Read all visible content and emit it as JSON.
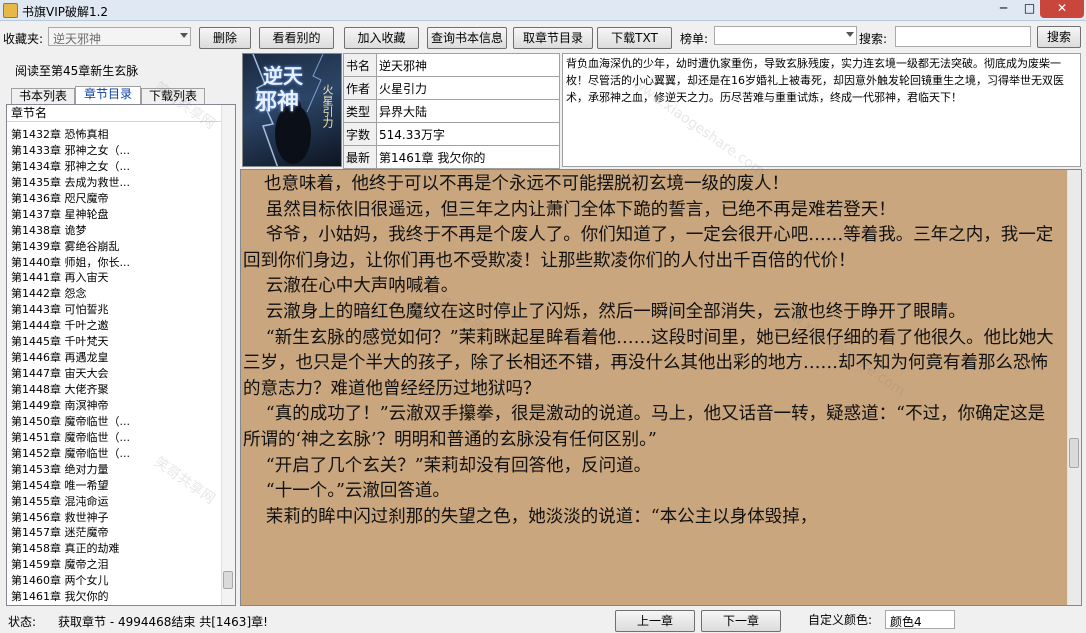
{
  "window": {
    "title": "书旗VIP破解1.2",
    "minimize": "─",
    "maximize": "□",
    "close": "✕"
  },
  "toolbar": {
    "favorites_label": "收藏夹:",
    "favorites_value": "逆天邪神",
    "delete_label": "删除",
    "see_other_label": "看看别的",
    "add_favorite_label": "加入收藏",
    "query_info_label": "查询书本信息",
    "fetch_toc_label": "取章节目录",
    "download_txt_label": "下载TXT",
    "ranking_label": "榜单:",
    "ranking_value": "",
    "search_label": "搜索:",
    "search_value": "",
    "search_button_label": "搜索"
  },
  "reading_progress": "阅读至第45章新生玄脉",
  "tabs": [
    {
      "label": "书本列表",
      "active": false
    },
    {
      "label": "章节目录",
      "active": true
    },
    {
      "label": "下载列表",
      "active": false
    }
  ],
  "chapter_list": {
    "header": "章节名",
    "items": [
      "第1432章 恐怖真相",
      "第1433章 邪神之女（...",
      "第1434章 邪神之女（...",
      "第1435章 去成为救世...",
      "第1436章 咫尺魔帝",
      "第1437章 星神轮盘",
      "第1438章 诡梦",
      "第1439章 雾绝谷崩乱",
      "第1440章 师姐，你长...",
      "第1441章 再入宙天",
      "第1442章 怨念",
      "第1443章 可怕誓兆",
      "第1444章 千叶之邀",
      "第1445章 千叶梵天",
      "第1446章 再遇龙皇",
      "第1447章 宙天大会",
      "第1448章 大佬齐聚",
      "第1449章 南溟神帝",
      "第1450章 魔帝临世（...",
      "第1451章 魔帝临世（...",
      "第1452章 魔帝临世（...",
      "第1453章 绝对力量",
      "第1454章 唯一希望",
      "第1455章 混沌命运",
      "第1456章 救世神子",
      "第1457章 迷茫魔帝",
      "第1458章 真正的劫难",
      "第1459章 魔帝之泪",
      "第1460章 两个女儿",
      "第1461章 我欠你的"
    ]
  },
  "cover": {
    "title_line1": "逆天",
    "title_line2": "邪神",
    "subtitle": "火星引力"
  },
  "book_info": {
    "title_key": "书名",
    "title": "逆天邪神",
    "author_key": "作者",
    "author": "火星引力",
    "genre_key": "类型",
    "genre": "异界大陆",
    "words_key": "字数",
    "words": "514.33万字",
    "latest_key": "最新",
    "latest": "第1461章 我欠你的"
  },
  "summary": "背负血海深仇的少年，幼时遭仇家重伤，导致玄脉残废，实力连玄境一级都无法突破。彻底成为废柴一枚！尽管活的小心翼翼，却还是在16岁婚礼上被毒死，却因意外触发轮回镜重生之境，习得举世无双医术，承邪神之血，修逆天之力。历尽苦难与重重试炼，终成一代邪神，君临天下！",
  "content": [
    "也意味着，他终于可以不再是个永远不可能摆脱初玄境一级的废人！",
    "虽然目标依旧很遥远，但三年之内让萧门全体下跪的誓言，已绝不再是难若登天！",
    "爷爷，小姑妈，我终于不再是个废人了。你们知道了，一定会很开心吧……等着我。三年之内，我一定回到你们身边，让你们再也不受欺凌！让那些欺凌你们的人付出千百倍的代价！",
    "云澈在心中大声呐喊着。",
    "云澈身上的暗红色魔纹在这时停止了闪烁，然后一瞬间全部消失，云澈也终于睁开了眼睛。",
    "“新生玄脉的感觉如何？”茉莉眯起星眸看着他……这段时间里，她已经很仔细的看了他很久。他比她大三岁，也只是个半大的孩子，除了长相还不错，再没什么其他出彩的地方……却不知为何竟有着那么恐怖的意志力？难道他曾经经历过地狱吗？",
    "“真的成功了！”云澈双手攥拳，很是激动的说道。马上，他又话音一转，疑惑道：“不过，你确定这是所谓的‘神之玄脉’？明明和普通的玄脉没有任何区别。”",
    "“开启了几个玄关？”茉莉却没有回答他，反问道。",
    "“十一个。”云澈回答道。",
    "茉莉的眸中闪过刹那的失望之色，她淡淡的说道：“本公主以身体毁掉，"
  ],
  "status": {
    "label": "状态:",
    "text": "获取章节 - 4994468结束 共[1463]章!",
    "prev_label": "上一章",
    "next_label": "下一章",
    "color_label": "自定义颜色:",
    "color_value": "颜色4"
  },
  "watermarks": [
    "www.xiaogeshare.com",
    "笑哥共享网"
  ],
  "colors": {
    "reader_bg": "#c9a67e",
    "title_bar": "#dfe8f3",
    "close": "#c9463d"
  }
}
